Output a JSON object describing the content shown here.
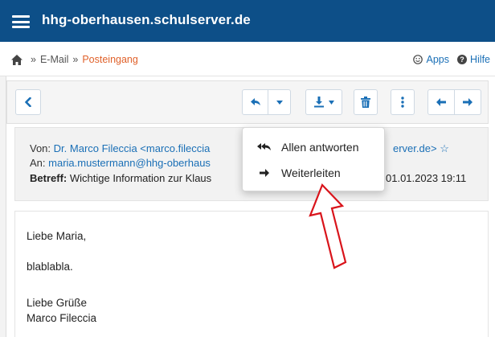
{
  "topbar": {
    "title": "hhg-oberhausen.schulserver.de"
  },
  "breadcrumb": {
    "home_sep": "»",
    "email": "E-Mail",
    "sep": "»",
    "inbox": "Posteingang"
  },
  "toplinks": {
    "apps": "Apps",
    "help": "Hilfe"
  },
  "email": {
    "from_label": "Von:",
    "from_value": "Dr. Marco Fileccia <marco.fileccia",
    "from_tail": "erver.de>",
    "star": "☆",
    "to_label": "An:",
    "to_value": "maria.mustermann@hhg-oberhaus",
    "subject_label": "Betreff:",
    "subject_value": "Wichtige Information zur Klaus",
    "date": "01.01.2023 19:11",
    "body": [
      "Liebe Maria,",
      "blablabla.",
      "Liebe Grüße",
      "Marco Fileccia"
    ]
  },
  "dropdown": {
    "items": [
      "Allen antworten",
      "Weiterleiten"
    ]
  },
  "colors": {
    "topbar": "#0d4f88",
    "link": "#1a6fb6",
    "active_crumb": "#e0612a",
    "annotation_arrow": "#d9141b"
  }
}
